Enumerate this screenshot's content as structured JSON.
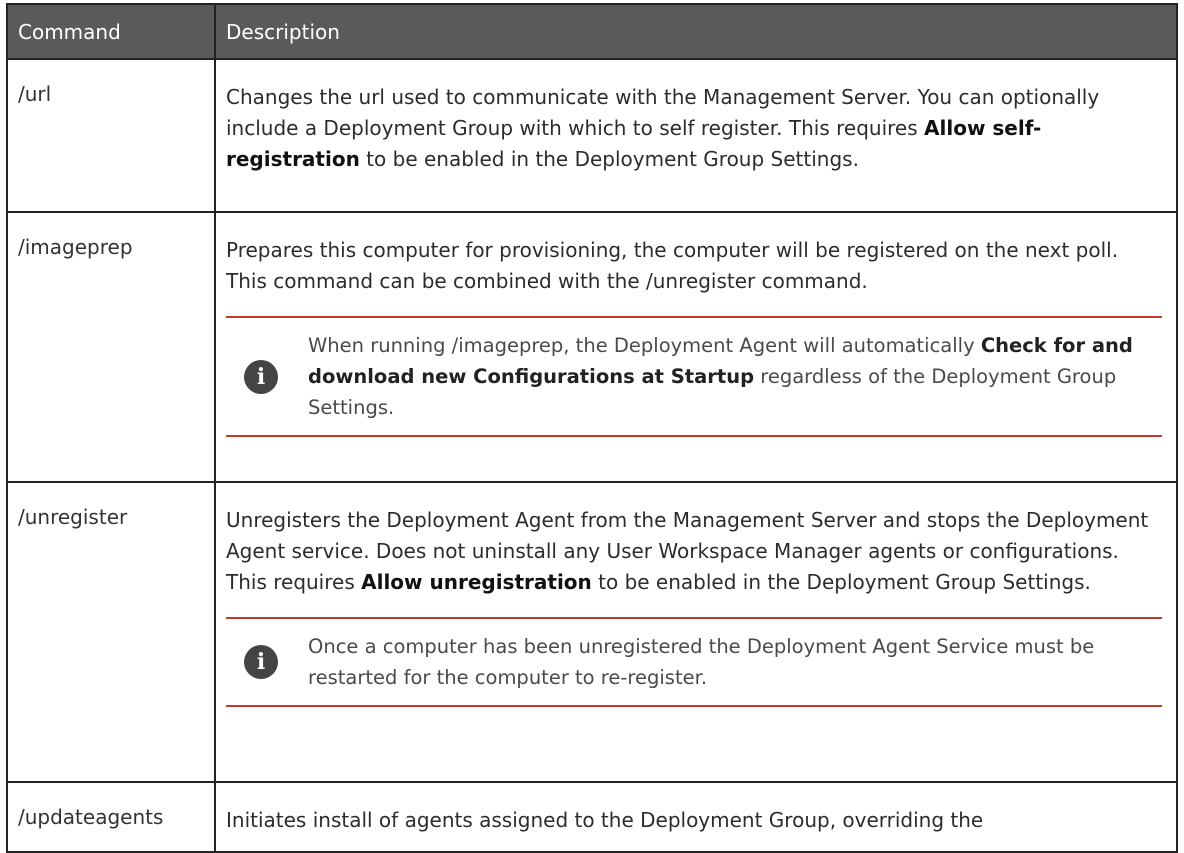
{
  "table": {
    "header": {
      "command": "Command",
      "description": "Description"
    },
    "rows": [
      {
        "command": "/url",
        "desc_text": "Changes the url used to communicate with the Management Server. You can optionally include a Deployment Group with which to self register. This requires ",
        "desc_bold": "Allow self-registration",
        "desc_after": " to be enabled in the Deployment Group Settings."
      },
      {
        "command": "/imageprep",
        "desc_text": "Prepares this computer for provisioning, the computer will be registered on the next poll. This command can be combined with the /unregister command.",
        "note_icon": "info-icon",
        "note_before": "When running /imageprep, the Deployment Agent will automatically ",
        "note_bold": "Check for and download new Configurations at Startup",
        "note_after": " regardless of the Deployment Group Settings."
      },
      {
        "command": "/unregister",
        "desc_text": "Unregisters the Deployment Agent from the Management Server and stops the Deployment Agent service. Does not uninstall any User Workspace Manager agents or configurations. This requires ",
        "desc_bold": "Allow unregistration",
        "desc_after": " to be enabled in the Deployment Group Settings.",
        "note_icon": "info-icon",
        "note_text": "Once a computer has been unregistered the Deployment Agent Service must be restarted for the computer to re-register."
      },
      {
        "command": "/updateagents",
        "desc_text": "Initiates install of agents assigned to the Deployment Group, overriding the"
      }
    ]
  },
  "colors": {
    "header_bg": "#5a5a5a",
    "note_rule": "#c0392b",
    "info_badge": "#444444"
  }
}
